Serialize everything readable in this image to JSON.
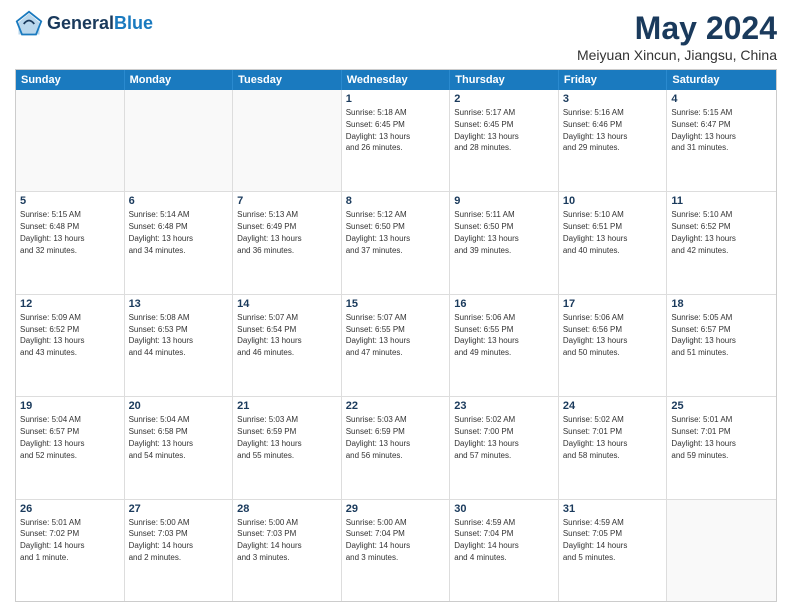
{
  "header": {
    "logo_line1": "General",
    "logo_line2": "Blue",
    "title": "May 2024",
    "subtitle": "Meiyuan Xincun, Jiangsu, China"
  },
  "weekdays": [
    "Sunday",
    "Monday",
    "Tuesday",
    "Wednesday",
    "Thursday",
    "Friday",
    "Saturday"
  ],
  "rows": [
    [
      {
        "day": "",
        "text": "",
        "empty": true
      },
      {
        "day": "",
        "text": "",
        "empty": true
      },
      {
        "day": "",
        "text": "",
        "empty": true
      },
      {
        "day": "1",
        "text": "Sunrise: 5:18 AM\nSunset: 6:45 PM\nDaylight: 13 hours\nand 26 minutes.",
        "empty": false
      },
      {
        "day": "2",
        "text": "Sunrise: 5:17 AM\nSunset: 6:45 PM\nDaylight: 13 hours\nand 28 minutes.",
        "empty": false
      },
      {
        "day": "3",
        "text": "Sunrise: 5:16 AM\nSunset: 6:46 PM\nDaylight: 13 hours\nand 29 minutes.",
        "empty": false
      },
      {
        "day": "4",
        "text": "Sunrise: 5:15 AM\nSunset: 6:47 PM\nDaylight: 13 hours\nand 31 minutes.",
        "empty": false
      }
    ],
    [
      {
        "day": "5",
        "text": "Sunrise: 5:15 AM\nSunset: 6:48 PM\nDaylight: 13 hours\nand 32 minutes.",
        "empty": false
      },
      {
        "day": "6",
        "text": "Sunrise: 5:14 AM\nSunset: 6:48 PM\nDaylight: 13 hours\nand 34 minutes.",
        "empty": false
      },
      {
        "day": "7",
        "text": "Sunrise: 5:13 AM\nSunset: 6:49 PM\nDaylight: 13 hours\nand 36 minutes.",
        "empty": false
      },
      {
        "day": "8",
        "text": "Sunrise: 5:12 AM\nSunset: 6:50 PM\nDaylight: 13 hours\nand 37 minutes.",
        "empty": false
      },
      {
        "day": "9",
        "text": "Sunrise: 5:11 AM\nSunset: 6:50 PM\nDaylight: 13 hours\nand 39 minutes.",
        "empty": false
      },
      {
        "day": "10",
        "text": "Sunrise: 5:10 AM\nSunset: 6:51 PM\nDaylight: 13 hours\nand 40 minutes.",
        "empty": false
      },
      {
        "day": "11",
        "text": "Sunrise: 5:10 AM\nSunset: 6:52 PM\nDaylight: 13 hours\nand 42 minutes.",
        "empty": false
      }
    ],
    [
      {
        "day": "12",
        "text": "Sunrise: 5:09 AM\nSunset: 6:52 PM\nDaylight: 13 hours\nand 43 minutes.",
        "empty": false
      },
      {
        "day": "13",
        "text": "Sunrise: 5:08 AM\nSunset: 6:53 PM\nDaylight: 13 hours\nand 44 minutes.",
        "empty": false
      },
      {
        "day": "14",
        "text": "Sunrise: 5:07 AM\nSunset: 6:54 PM\nDaylight: 13 hours\nand 46 minutes.",
        "empty": false
      },
      {
        "day": "15",
        "text": "Sunrise: 5:07 AM\nSunset: 6:55 PM\nDaylight: 13 hours\nand 47 minutes.",
        "empty": false
      },
      {
        "day": "16",
        "text": "Sunrise: 5:06 AM\nSunset: 6:55 PM\nDaylight: 13 hours\nand 49 minutes.",
        "empty": false
      },
      {
        "day": "17",
        "text": "Sunrise: 5:06 AM\nSunset: 6:56 PM\nDaylight: 13 hours\nand 50 minutes.",
        "empty": false
      },
      {
        "day": "18",
        "text": "Sunrise: 5:05 AM\nSunset: 6:57 PM\nDaylight: 13 hours\nand 51 minutes.",
        "empty": false
      }
    ],
    [
      {
        "day": "19",
        "text": "Sunrise: 5:04 AM\nSunset: 6:57 PM\nDaylight: 13 hours\nand 52 minutes.",
        "empty": false
      },
      {
        "day": "20",
        "text": "Sunrise: 5:04 AM\nSunset: 6:58 PM\nDaylight: 13 hours\nand 54 minutes.",
        "empty": false
      },
      {
        "day": "21",
        "text": "Sunrise: 5:03 AM\nSunset: 6:59 PM\nDaylight: 13 hours\nand 55 minutes.",
        "empty": false
      },
      {
        "day": "22",
        "text": "Sunrise: 5:03 AM\nSunset: 6:59 PM\nDaylight: 13 hours\nand 56 minutes.",
        "empty": false
      },
      {
        "day": "23",
        "text": "Sunrise: 5:02 AM\nSunset: 7:00 PM\nDaylight: 13 hours\nand 57 minutes.",
        "empty": false
      },
      {
        "day": "24",
        "text": "Sunrise: 5:02 AM\nSunset: 7:01 PM\nDaylight: 13 hours\nand 58 minutes.",
        "empty": false
      },
      {
        "day": "25",
        "text": "Sunrise: 5:01 AM\nSunset: 7:01 PM\nDaylight: 13 hours\nand 59 minutes.",
        "empty": false
      }
    ],
    [
      {
        "day": "26",
        "text": "Sunrise: 5:01 AM\nSunset: 7:02 PM\nDaylight: 14 hours\nand 1 minute.",
        "empty": false
      },
      {
        "day": "27",
        "text": "Sunrise: 5:00 AM\nSunset: 7:03 PM\nDaylight: 14 hours\nand 2 minutes.",
        "empty": false
      },
      {
        "day": "28",
        "text": "Sunrise: 5:00 AM\nSunset: 7:03 PM\nDaylight: 14 hours\nand 3 minutes.",
        "empty": false
      },
      {
        "day": "29",
        "text": "Sunrise: 5:00 AM\nSunset: 7:04 PM\nDaylight: 14 hours\nand 3 minutes.",
        "empty": false
      },
      {
        "day": "30",
        "text": "Sunrise: 4:59 AM\nSunset: 7:04 PM\nDaylight: 14 hours\nand 4 minutes.",
        "empty": false
      },
      {
        "day": "31",
        "text": "Sunrise: 4:59 AM\nSunset: 7:05 PM\nDaylight: 14 hours\nand 5 minutes.",
        "empty": false
      },
      {
        "day": "",
        "text": "",
        "empty": true
      }
    ]
  ]
}
